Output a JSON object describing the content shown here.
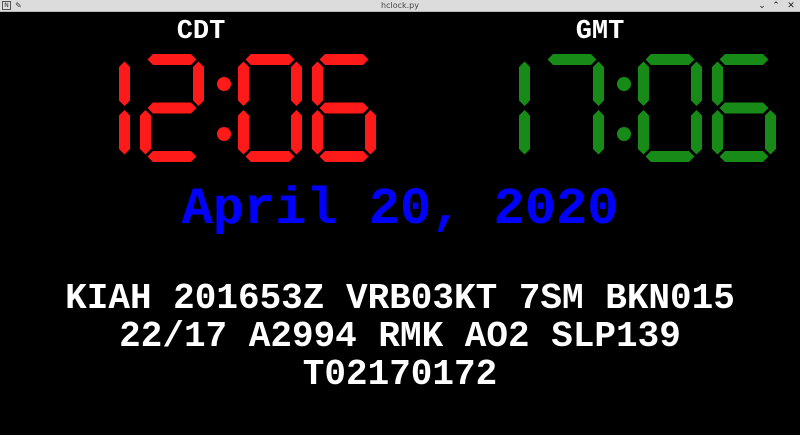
{
  "window": {
    "title": "hclock.py",
    "app_icon": "app-menu-icon",
    "pin_icon": "pin-icon",
    "minimize_glyph": "⌄",
    "maximize_glyph": "⌃",
    "close_glyph": "✕"
  },
  "clocks": [
    {
      "zone": "CDT",
      "time": "12:06",
      "color": "#ff1a1a"
    },
    {
      "zone": "GMT",
      "time": "17:06",
      "color": "#178a17"
    }
  ],
  "date": {
    "text": "April 20, 2020",
    "color": "#0000ff"
  },
  "metar": {
    "lines": [
      "KIAH 201653Z VRB03KT 7SM BKN015",
      "22/17 A2994 RMK AO2 SLP139",
      "T02170172"
    ],
    "color": "#ffffff"
  },
  "colors": {
    "background": "#000000",
    "titlebar": "#dcdcdc"
  }
}
